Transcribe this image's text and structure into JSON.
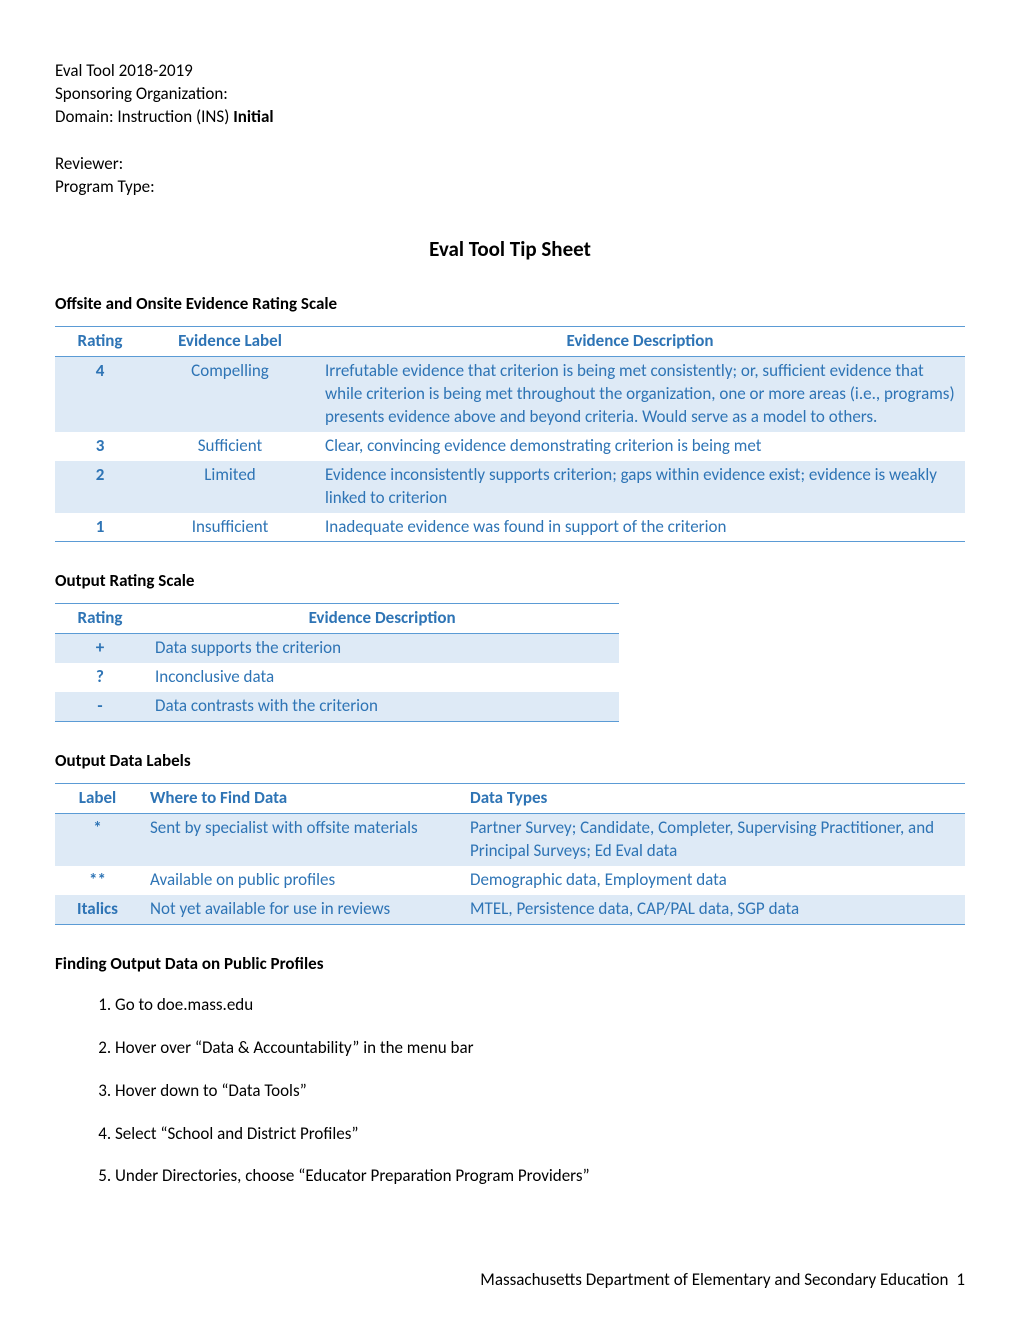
{
  "header": {
    "line1": "Eval Tool 2018-2019",
    "line2": "Sponsoring Organization:",
    "line3_plain": "Domain: Instruction (INS) ",
    "line3_bold": "Initial",
    "line4": "Reviewer:",
    "line5": "Program Type:"
  },
  "title": "Eval Tool Tip Sheet",
  "section1": {
    "heading": "Offsite and Onsite Evidence Rating Scale",
    "cols": {
      "rating": "Rating",
      "label": "Evidence Label",
      "desc": "Evidence Description"
    },
    "rows": [
      {
        "rating": "4",
        "label": "Compelling",
        "desc": "Irrefutable evidence that criterion is being met consistently; or, sufficient evidence that while criterion is being met throughout the organization, one or more areas (i.e., programs) presents evidence above and beyond criteria. Would serve as a model to others."
      },
      {
        "rating": "3",
        "label": "Sufficient",
        "desc": "Clear, convincing evidence demonstrating criterion is being met"
      },
      {
        "rating": "2",
        "label": "Limited",
        "desc": "Evidence inconsistently supports criterion; gaps within evidence exist; evidence is weakly linked to criterion"
      },
      {
        "rating": "1",
        "label": "Insufficient",
        "desc": "Inadequate evidence was found in support of the criterion"
      }
    ]
  },
  "section2": {
    "heading": "Output Rating Scale",
    "cols": {
      "rating": "Rating",
      "desc": "Evidence Description"
    },
    "rows": [
      {
        "rating": "+",
        "desc": "Data supports the criterion"
      },
      {
        "rating": "?",
        "desc": "Inconclusive data"
      },
      {
        "rating": "-",
        "desc": "Data contrasts with the criterion"
      }
    ]
  },
  "section3": {
    "heading": "Output Data Labels",
    "cols": {
      "label": "Label",
      "where": "Where to Find Data",
      "types": "Data Types"
    },
    "rows": [
      {
        "label": "*",
        "where": "Sent by specialist with offsite materials",
        "types": "Partner Survey; Candidate, Completer, Supervising Practitioner, and Principal Surveys; Ed Eval data"
      },
      {
        "label": "**",
        "where": "Available on public profiles",
        "types": "Demographic data, Employment data"
      },
      {
        "label": "Italics",
        "where": "Not yet available for use in reviews",
        "types": "MTEL, Persistence data, CAP/PAL data, SGP data"
      }
    ]
  },
  "section4": {
    "heading": "Finding Output Data on Public Profiles",
    "steps": [
      "Go to doe.mass.edu",
      "Hover over “Data & Accountability” in the menu bar",
      "Hover down to “Data Tools”",
      "Select “School and District Profiles”",
      "Under Directories, choose “Educator Preparation Program Providers”"
    ]
  },
  "footer": {
    "org": "Massachusetts Department of Elementary and Secondary Education",
    "page": "1"
  }
}
